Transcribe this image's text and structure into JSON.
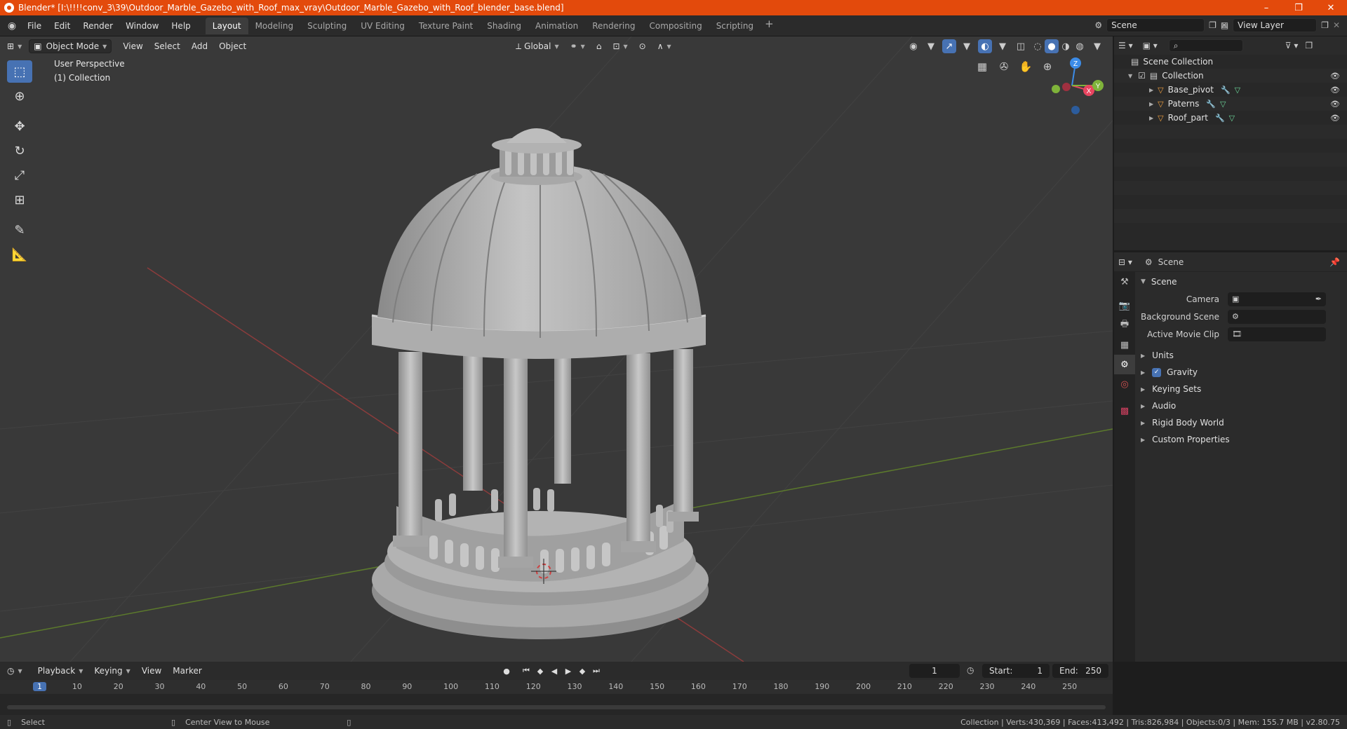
{
  "titlebar": {
    "title": "Blender* [I:\\!!!!conv_3\\39\\Outdoor_Marble_Gazebo_with_Roof_max_vray\\Outdoor_Marble_Gazebo_with_Roof_blender_base.blend]",
    "minimize": "–",
    "maximize": "❐",
    "close": "✕"
  },
  "menu": [
    "File",
    "Edit",
    "Render",
    "Window",
    "Help"
  ],
  "workspaces": [
    "Layout",
    "Modeling",
    "Sculpting",
    "UV Editing",
    "Texture Paint",
    "Shading",
    "Animation",
    "Rendering",
    "Compositing",
    "Scripting"
  ],
  "active_workspace": "Layout",
  "scene_name": "Scene",
  "view_layer_name": "View Layer",
  "viewport": {
    "mode": "Object Mode",
    "menus": [
      "View",
      "Select",
      "Add",
      "Object"
    ],
    "transform_orientation": "Global",
    "perspective_label": "User Perspective",
    "collection_label": "(1) Collection",
    "gizmo": {
      "x": "X",
      "y": "Y",
      "z": "Z"
    }
  },
  "outliner": {
    "root": "Scene Collection",
    "collection": "Collection",
    "objects": [
      "Base_pivot",
      "Paterns",
      "Roof_part"
    ]
  },
  "properties": {
    "header": "Scene",
    "panel": "Scene",
    "fields": [
      {
        "label": "Camera"
      },
      {
        "label": "Background Scene"
      },
      {
        "label": "Active Movie Clip"
      }
    ],
    "subpanels": [
      "Units",
      "Gravity",
      "Keying Sets",
      "Audio",
      "Rigid Body World",
      "Custom Properties"
    ],
    "gravity_checked": true
  },
  "timeline": {
    "menus": [
      "Playback",
      "Keying",
      "View",
      "Marker"
    ],
    "current_frame": "1",
    "start_label": "Start:",
    "start": "1",
    "end_label": "End:",
    "end": "250",
    "ruler": [
      "1",
      "10",
      "20",
      "30",
      "40",
      "50",
      "60",
      "70",
      "80",
      "90",
      "100",
      "110",
      "120",
      "130",
      "140",
      "150",
      "160",
      "170",
      "180",
      "190",
      "200",
      "210",
      "220",
      "230",
      "240",
      "250"
    ]
  },
  "statusbar": {
    "left_action": "Select",
    "middle_action": "Center View to Mouse",
    "stats": "Collection | Verts:430,369 | Faces:413,492 | Tris:826,984 | Objects:0/3 | Mem: 155.7 MB | v2.80.75"
  },
  "colors": {
    "accent": "#4772b3",
    "titlebar": "#e34a0c",
    "viewport_bg": "#393939",
    "axis_x": "#e84560",
    "axis_y": "#7fb33a",
    "axis_z": "#3c8ce8"
  }
}
